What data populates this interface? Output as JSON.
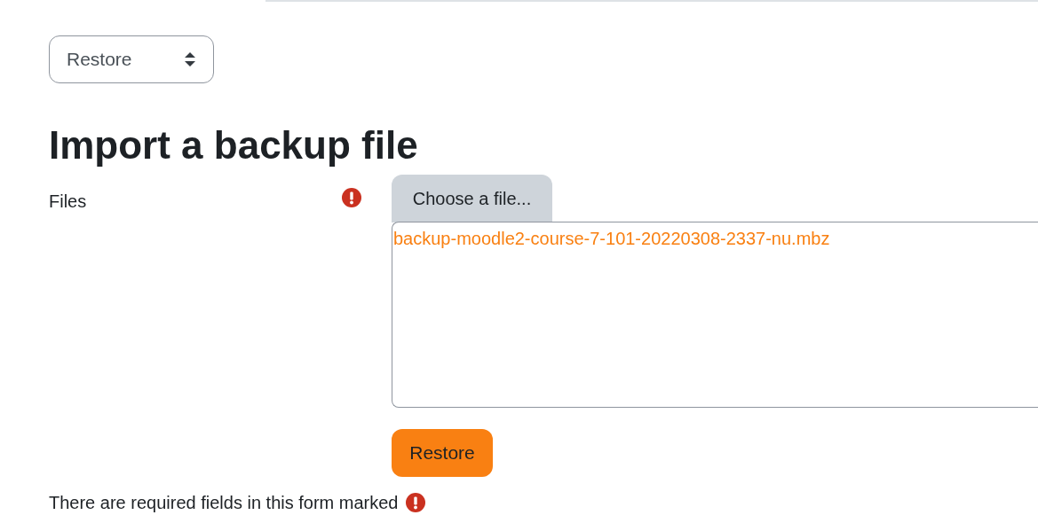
{
  "select": {
    "value": "Restore"
  },
  "heading": "Import a backup file",
  "files_field": {
    "label": "Files",
    "required": true,
    "button": "Choose a file...",
    "files": [
      "backup-moodle2-course-7-101-20220308-2337-nu.mbz"
    ]
  },
  "submit": "Restore",
  "footer_note": {
    "text": "There are required fields in this form marked",
    "required": true
  }
}
